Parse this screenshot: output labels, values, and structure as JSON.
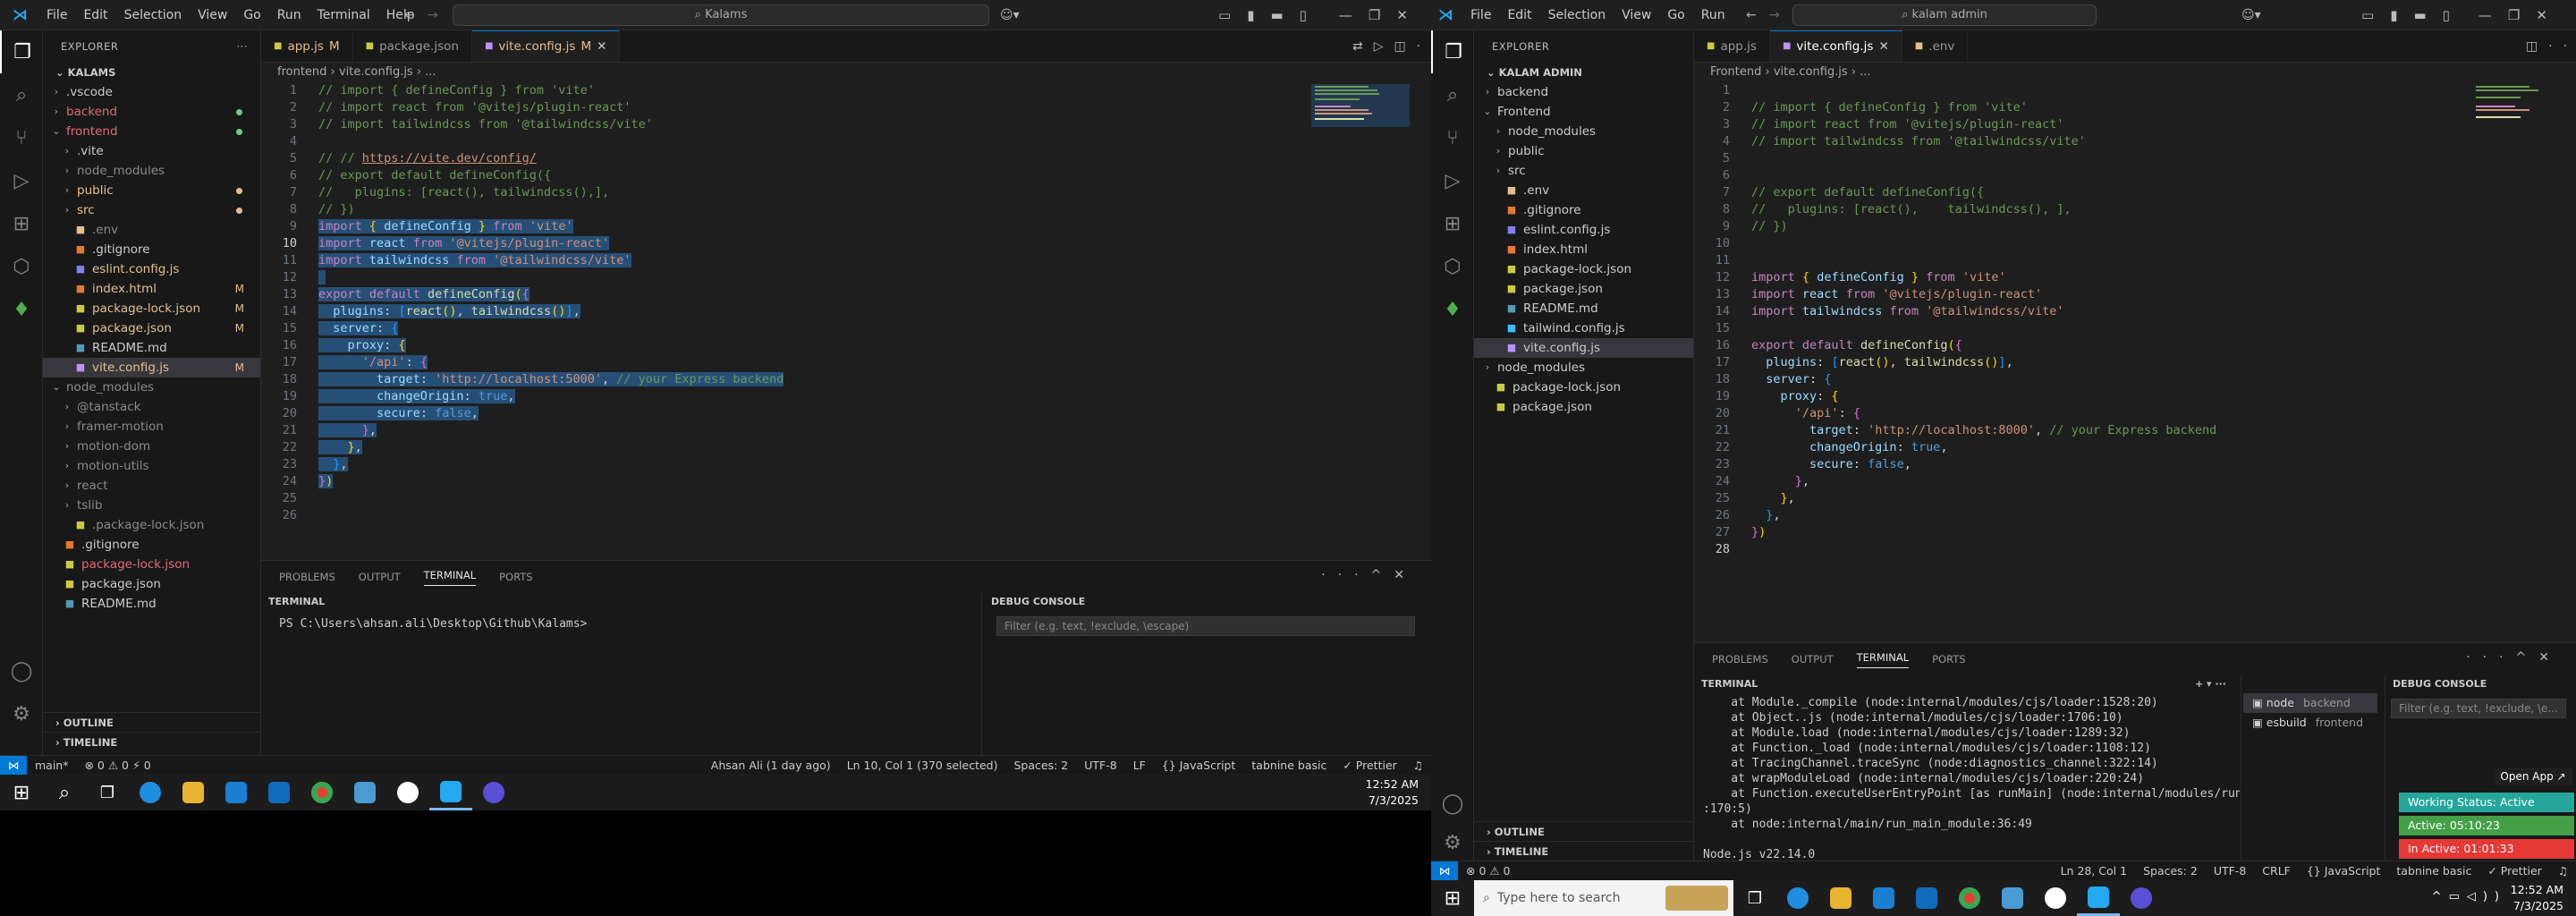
{
  "left": {
    "menu": [
      "File",
      "Edit",
      "Selection",
      "View",
      "Go",
      "Run",
      "Terminal",
      "Help"
    ],
    "search": "Kalams",
    "explorer_title": "EXPLORER",
    "root": "KALAMS",
    "tree": [
      {
        "label": ".vscode",
        "type": "folder",
        "depth": 1,
        "open": false
      },
      {
        "label": "backend",
        "type": "folder",
        "depth": 1,
        "open": false,
        "color": "#e06c75",
        "dot": "#73c991"
      },
      {
        "label": "frontend",
        "type": "folder",
        "depth": 1,
        "open": true,
        "color": "#e06c75",
        "dot": "#73c991"
      },
      {
        "label": ".vite",
        "type": "folder",
        "depth": 2,
        "open": false
      },
      {
        "label": "node_modules",
        "type": "folder",
        "depth": 2,
        "open": false,
        "color": "#8b8b8b"
      },
      {
        "label": "public",
        "type": "folder",
        "depth": 2,
        "open": false,
        "color": "#e2c08d",
        "dot": "#e2c08d"
      },
      {
        "label": "src",
        "type": "folder",
        "depth": 2,
        "open": false,
        "color": "#e2c08d",
        "dot": "#e2c08d"
      },
      {
        "label": ".env",
        "type": "file",
        "depth": 2,
        "icon": "#e2c08d",
        "color": "#8b8b8b"
      },
      {
        "label": ".gitignore",
        "type": "file",
        "depth": 2,
        "icon": "#e37933"
      },
      {
        "label": "eslint.config.js",
        "type": "file",
        "depth": 2,
        "icon": "#8080f2",
        "color": "#e2c08d"
      },
      {
        "label": "index.html",
        "type": "file",
        "depth": 2,
        "icon": "#e37933",
        "color": "#e2c08d",
        "badge": "M"
      },
      {
        "label": "package-lock.json",
        "type": "file",
        "depth": 2,
        "icon": "#cbcb41",
        "color": "#e2c08d",
        "badge": "M"
      },
      {
        "label": "package.json",
        "type": "file",
        "depth": 2,
        "icon": "#cbcb41",
        "color": "#e2c08d",
        "badge": "M"
      },
      {
        "label": "README.md",
        "type": "file",
        "depth": 2,
        "icon": "#519aba"
      },
      {
        "label": "vite.config.js",
        "type": "file",
        "depth": 2,
        "icon": "#bd93f9",
        "color": "#e2c08d",
        "badge": "M",
        "selected": true
      },
      {
        "label": "node_modules",
        "type": "folder",
        "depth": 1,
        "open": true,
        "color": "#8b8b8b"
      },
      {
        "label": "@tanstack",
        "type": "folder",
        "depth": 2,
        "open": false,
        "color": "#8b8b8b"
      },
      {
        "label": "framer-motion",
        "type": "folder",
        "depth": 2,
        "open": false,
        "color": "#8b8b8b"
      },
      {
        "label": "motion-dom",
        "type": "folder",
        "depth": 2,
        "open": false,
        "color": "#8b8b8b"
      },
      {
        "label": "motion-utils",
        "type": "folder",
        "depth": 2,
        "open": false,
        "color": "#8b8b8b"
      },
      {
        "label": "react",
        "type": "folder",
        "depth": 2,
        "open": false,
        "color": "#8b8b8b"
      },
      {
        "label": "tslib",
        "type": "folder",
        "depth": 2,
        "open": false,
        "color": "#8b8b8b"
      },
      {
        "label": ".package-lock.json",
        "type": "file",
        "depth": 2,
        "icon": "#cbcb41",
        "color": "#8b8b8b"
      },
      {
        "label": ".gitignore",
        "type": "file",
        "depth": 1,
        "icon": "#e37933"
      },
      {
        "label": "package-lock.json",
        "type": "file",
        "depth": 1,
        "icon": "#cbcb41",
        "color": "#e06c75"
      },
      {
        "label": "package.json",
        "type": "file",
        "depth": 1,
        "icon": "#cbcb41"
      },
      {
        "label": "README.md",
        "type": "file",
        "depth": 1,
        "icon": "#519aba"
      }
    ],
    "outline": "OUTLINE",
    "timeline": "TIMELINE",
    "tabs": [
      {
        "label": "app.js",
        "mod": "M",
        "icon": "#cbcb41"
      },
      {
        "label": "package.json",
        "mod": "",
        "icon": "#cbcb41"
      },
      {
        "label": "vite.config.js",
        "mod": "M",
        "icon": "#bd93f9",
        "active": true
      }
    ],
    "breadcrumb": "frontend  ›  vite.config.js  ›  ...",
    "code": [
      "<span class=\"cm\">// import { defineConfig } from 'vite'</span>",
      "<span class=\"cm\">// import react from '@vitejs/plugin-react'</span>",
      "<span class=\"cm\">// import tailwindcss from '@tailwindcss/vite'</span>",
      "",
      "<span class=\"cm\">// // <span class=\"lnk\">https://vite.dev/config/</span></span>",
      "<span class=\"cm\">// export default defineConfig({</span>",
      "<span class=\"cm\">//   plugins: [react(), tailwindcss(),],</span>",
      "<span class=\"cm\">// })</span>",
      "<span class=\"selbg\"><span class=\"kw\">import</span> <span class=\"br\">{</span> <span class=\"pr\">defineConfig</span> <span class=\"br\">}</span> <span class=\"kw\">from</span> <span class=\"st\">'vite'</span></span>",
      "<span class=\"selbg\"><span class=\"kw\">import</span> <span class=\"pr\">react</span> <span class=\"kw\">from</span> <span class=\"st\">'@vitejs/plugin-react'</span></span>",
      "<span class=\"selbg\"><span class=\"kw\">import</span> <span class=\"pr\">tailwindcss</span> <span class=\"kw\">from</span> <span class=\"st\">'@tailwindcss/vite'</span></span>",
      "<span class=\"selbg\"> </span>",
      "<span class=\"selbg\"><span class=\"kw\">export</span> <span class=\"kw\">default</span> <span class=\"fn\">defineConfig</span><span class=\"br\">(</span><span class=\"br2\">{</span></span>",
      "<span class=\"selbg\">  <span class=\"pr\">plugins</span>: <span class=\"br3\">[</span><span class=\"fn\">react</span><span class=\"br\">()</span>, <span class=\"fn\">tailwindcss</span><span class=\"br\">()</span><span class=\"br3\">]</span>,</span>",
      "<span class=\"selbg\">  <span class=\"pr\">server</span>: <span class=\"br3\">{</span></span>",
      "<span class=\"selbg\">    <span class=\"pr\">proxy</span>: <span class=\"br\">{</span></span>",
      "<span class=\"selbg\">      <span class=\"st\">'/api'</span>: <span class=\"br2\">{</span></span>",
      "<span class=\"selbg\">        <span class=\"pr\">target</span>: <span class=\"st\">'http://localhost:5000'</span>, <span class=\"cm\">// your Express backend</span></span>",
      "<span class=\"selbg\">        <span class=\"pr\">changeOrigin</span>: <span class=\"bl\">true</span>,</span>",
      "<span class=\"selbg\">        <span class=\"pr\">secure</span>: <span class=\"bl\">false</span>,</span>",
      "<span class=\"selbg\">      <span class=\"br2\">}</span>,</span>",
      "<span class=\"selbg\">    <span class=\"br\">}</span>,</span>",
      "<span class=\"selbg\">  <span class=\"br3\">}</span>,</span>",
      "<span class=\"selbg\"><span class=\"br2\">}</span><span class=\"br\">)</span></span>",
      "",
      ""
    ],
    "current_line": 10,
    "panel_tabs": [
      "PROBLEMS",
      "OUTPUT",
      "TERMINAL",
      "PORTS"
    ],
    "terminal_head": "TERMINAL",
    "debug_head": "DEBUG CONSOLE",
    "terminal_lines": [
      "PS C:\\Users\\ahsan.ali\\Desktop\\Github\\Kalams> "
    ],
    "filter_placeholder": "Filter (e.g. text, !exclude, \\escape)",
    "status_left": [
      "main*",
      "⊗ 0 ⚠ 0  ⚡ 0"
    ],
    "status_right": [
      "Ahsan Ali (1 day ago)",
      "Ln 10, Col 1 (370 selected)",
      "Spaces: 2",
      "UTF-8",
      "LF",
      "{} JavaScript",
      "tabnine basic",
      "✓ Prettier"
    ]
  },
  "right": {
    "menu": [
      "File",
      "Edit",
      "Selection",
      "View",
      "Go",
      "Run"
    ],
    "search": "kalam admin",
    "explorer_title": "EXPLORER",
    "root": "KALAM ADMIN",
    "tree": [
      {
        "label": "backend",
        "type": "folder",
        "depth": 1,
        "open": false
      },
      {
        "label": "Frontend",
        "type": "folder",
        "depth": 1,
        "open": true
      },
      {
        "label": "node_modules",
        "type": "folder",
        "depth": 2,
        "open": false
      },
      {
        "label": "public",
        "type": "folder",
        "depth": 2,
        "open": false
      },
      {
        "label": "src",
        "type": "folder",
        "depth": 2,
        "open": false
      },
      {
        "label": ".env",
        "type": "file",
        "depth": 2,
        "icon": "#e2c08d"
      },
      {
        "label": ".gitignore",
        "type": "file",
        "depth": 2,
        "icon": "#e37933"
      },
      {
        "label": "eslint.config.js",
        "type": "file",
        "depth": 2,
        "icon": "#8080f2"
      },
      {
        "label": "index.html",
        "type": "file",
        "depth": 2,
        "icon": "#e37933"
      },
      {
        "label": "package-lock.json",
        "type": "file",
        "depth": 2,
        "icon": "#cbcb41"
      },
      {
        "label": "package.json",
        "type": "file",
        "depth": 2,
        "icon": "#cbcb41"
      },
      {
        "label": "README.md",
        "type": "file",
        "depth": 2,
        "icon": "#519aba"
      },
      {
        "label": "tailwind.config.js",
        "type": "file",
        "depth": 2,
        "icon": "#38bdf8"
      },
      {
        "label": "vite.config.js",
        "type": "file",
        "depth": 2,
        "icon": "#bd93f9",
        "selected": true
      },
      {
        "label": "node_modules",
        "type": "folder",
        "depth": 1,
        "open": false
      },
      {
        "label": "package-lock.json",
        "type": "file",
        "depth": 1,
        "icon": "#cbcb41"
      },
      {
        "label": "package.json",
        "type": "file",
        "depth": 1,
        "icon": "#cbcb41"
      }
    ],
    "outline": "OUTLINE",
    "timeline": "TIMELINE",
    "tabs": [
      {
        "label": "app.js",
        "mod": "",
        "icon": "#cbcb41"
      },
      {
        "label": "vite.config.js",
        "mod": "",
        "icon": "#bd93f9",
        "active": true
      },
      {
        "label": ".env",
        "mod": "",
        "icon": "#e2c08d"
      }
    ],
    "breadcrumb": "Frontend  ›  vite.config.js  ›  ...",
    "code": [
      "",
      "<span class=\"cm\">// import { defineConfig } from 'vite'</span>",
      "<span class=\"cm\">// import react from '@vitejs/plugin-react'</span>",
      "<span class=\"cm\">// import tailwindcss from '@tailwindcss/vite'</span>",
      "",
      "",
      "<span class=\"cm\">// export default defineConfig({</span>",
      "<span class=\"cm\">//   plugins: [react(),    tailwindcss(), ],</span>",
      "<span class=\"cm\">// })</span>",
      "",
      "",
      "<span class=\"kw\">import</span> <span class=\"br\">{</span> <span class=\"pr\">defineConfig</span> <span class=\"br\">}</span> <span class=\"kw\">from</span> <span class=\"st\">'vite'</span>",
      "<span class=\"kw\">import</span> <span class=\"pr\">react</span> <span class=\"kw\">from</span> <span class=\"st\">'@vitejs/plugin-react'</span>",
      "<span class=\"kw\">import</span> <span class=\"pr\">tailwindcss</span> <span class=\"kw\">from</span> <span class=\"st\">'@tailwindcss/vite'</span>",
      "",
      "<span class=\"kw\">export</span> <span class=\"kw\">default</span> <span class=\"fn\">defineConfig</span><span class=\"br\">(</span><span class=\"br2\">{</span>",
      "  <span class=\"pr\">plugins</span>: <span class=\"br3\">[</span><span class=\"fn\">react</span><span class=\"br\">()</span>, <span class=\"fn\">tailwindcss</span><span class=\"br\">()</span><span class=\"br3\">]</span>,",
      "  <span class=\"pr\">server</span>: <span class=\"br3\">{</span>",
      "    <span class=\"pr\">proxy</span>: <span class=\"br\">{</span>",
      "      <span class=\"st\">'/api'</span>: <span class=\"br2\">{</span>",
      "        <span class=\"pr\">target</span>: <span class=\"st\">'http://localhost:8000'</span>, <span class=\"cm\">// your Express backend</span>",
      "        <span class=\"pr\">changeOrigin</span>: <span class=\"bl\">true</span>,",
      "        <span class=\"pr\">secure</span>: <span class=\"bl\">false</span>,",
      "      <span class=\"br2\">}</span>,",
      "    <span class=\"br\">}</span>,",
      "  <span class=\"br3\">}</span>,",
      "<span class=\"br2\">}</span><span class=\"br\">)</span>",
      ""
    ],
    "current_line": 28,
    "panel_tabs": [
      "PROBLEMS",
      "OUTPUT",
      "TERMINAL",
      "PORTS"
    ],
    "terminal_head": "TERMINAL",
    "debug_head": "DEBUG CONSOLE",
    "terminal_lines": [
      "    at Module._compile (node:internal/modules/cjs/loader:1528:20)",
      "    at Object..js (node:internal/modules/cjs/loader:1706:10)",
      "    at Module.load (node:internal/modules/cjs/loader:1289:32)",
      "    at Function._load (node:internal/modules/cjs/loader:1108:12)",
      "    at TracingChannel.traceSync (node:diagnostics_channel:322:14)",
      "    at wrapModuleLoad (node:internal/modules/cjs/loader:220:24)",
      "    at Function.executeUserEntryPoint [as runMain] (node:internal/modules/run_main",
      ":170:5)",
      "    at node:internal/main/run_main_module:36:49",
      "",
      "Node.js v22.14.0"
    ],
    "terminal_list": [
      {
        "name": "node",
        "sub": "backend"
      },
      {
        "name": "esbuild",
        "sub": "frontend"
      }
    ],
    "filter_placeholder": "Filter (e.g. text, !exclude, \\e...",
    "open_app": "Open App ↗",
    "working_status": "Working Status: Active",
    "active_time": "Active: 05:10:23",
    "inactive_time": "In Active: 01:01:33",
    "status_left": [
      "⊗ 0 ⚠ 0"
    ],
    "status_right": [
      "Ln 28, Col 1",
      "Spaces: 2",
      "UTF-8",
      "CRLF",
      "{} JavaScript",
      "tabnine basic",
      "✓ Prettier"
    ]
  },
  "taskbar_left": {
    "time": "12:52 AM",
    "date": "7/3/2025"
  },
  "taskbar_right": {
    "time": "12:52 AM",
    "date": "7/3/2025",
    "search_placeholder": "Type here to search"
  }
}
